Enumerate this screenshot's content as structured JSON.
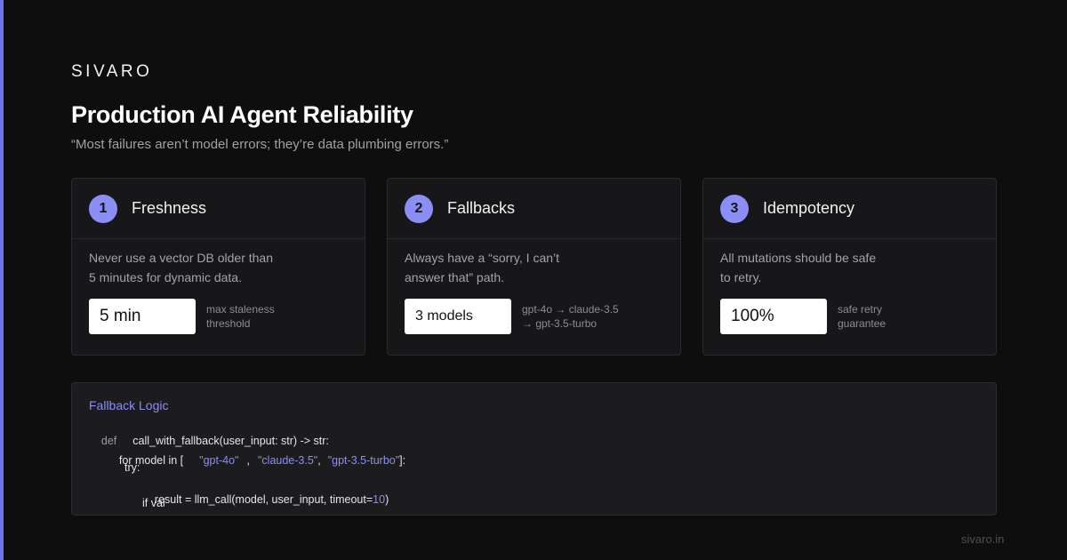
{
  "brand": "SIVARO",
  "title": "Production AI Agent Reliability",
  "quote": "“Most failures aren’t model errors; they’re data plumbing errors.”",
  "colors": {
    "accent": "#8a8ef5",
    "background": "#0e0e0f",
    "card": "#17171a"
  },
  "cards": [
    {
      "number": "1",
      "title": "Freshness",
      "desc_line1": "Never use a vector DB older than",
      "desc_line2": "5 minutes for dynamic data.",
      "metric": "5 min",
      "note_line1": "max staleness",
      "note_line2": "threshold"
    },
    {
      "number": "2",
      "title": "Fallbacks",
      "desc_line1": "Always have a “sorry, I can’t",
      "desc_line2": "answer that” path.",
      "metric": "3 models",
      "note_line1": "gpt-4o → claude-3.5",
      "note_line2": "→ gpt-3.5-turbo"
    },
    {
      "number": "3",
      "title": "Idempotency",
      "desc_line1": "All mutations should be safe",
      "desc_line2": "to retry.",
      "metric": "100%",
      "note_line1": "safe retry",
      "note_line2": "guarantee"
    }
  ],
  "code": {
    "label": "Fallback Logic",
    "line1_kw": "def",
    "line1_rest": "call_with_fallback(user_input: str) -> str:",
    "line2_start": "for model in [",
    "line2_s1": "\"gpt-4o\"",
    "line2_comma1": ",",
    "line2_s2": "\"claude-3.5\"",
    "line2_comma2": ",",
    "line2_s3": "\"gpt-3.5-turbo\"",
    "line2_end": "]:",
    "line3": "try:",
    "line4_start": "result = llm_call(model, user_input, timeout=",
    "line4_num": "10",
    "line4_end": ")",
    "line5": "if val"
  },
  "footer": "sivaro.in"
}
